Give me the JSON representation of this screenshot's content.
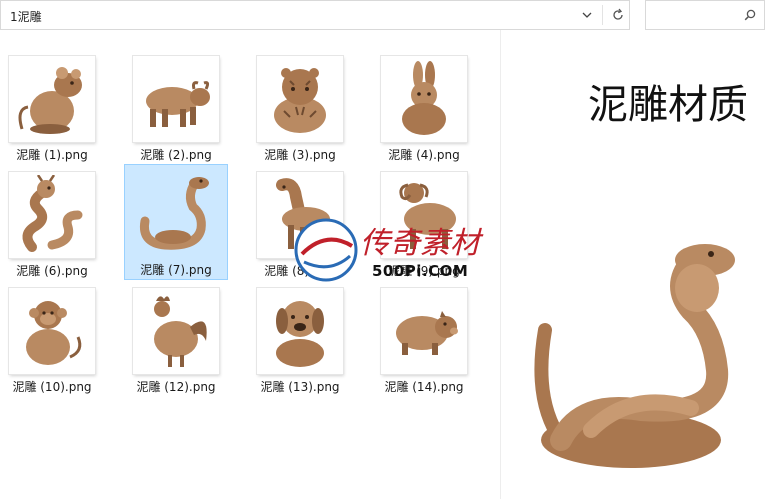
{
  "address_bar": {
    "path": "1泥雕"
  },
  "search": {
    "placeholder": ""
  },
  "files": [
    {
      "label": "泥雕 (1).png",
      "subject": "rat"
    },
    {
      "label": "泥雕 (2).png",
      "subject": "ox"
    },
    {
      "label": "泥雕 (3).png",
      "subject": "tiger"
    },
    {
      "label": "泥雕 (4).png",
      "subject": "rabbit"
    },
    {
      "label": "泥雕 (6).png",
      "subject": "dragon"
    },
    {
      "label": "泥雕 (7).png",
      "subject": "snake",
      "selected": true
    },
    {
      "label": "泥雕 (8).png",
      "subject": "horse"
    },
    {
      "label": "泥雕 (9).png",
      "subject": "goat"
    },
    {
      "label": "泥雕 (10).png",
      "subject": "monkey"
    },
    {
      "label": "泥雕 (12).png",
      "subject": "rooster"
    },
    {
      "label": "泥雕 (13).png",
      "subject": "dog"
    },
    {
      "label": "泥雕 (14).png",
      "subject": "pig"
    }
  ],
  "preview": {
    "title": "泥雕材质"
  },
  "watermark": {
    "chinese": "传奇素材",
    "site": "500Pi.COM"
  },
  "colors": {
    "clay": "#b98a62",
    "clay_dark": "#8a5f3e",
    "selection": "#cce8ff",
    "selection_border": "#99d1ff"
  }
}
